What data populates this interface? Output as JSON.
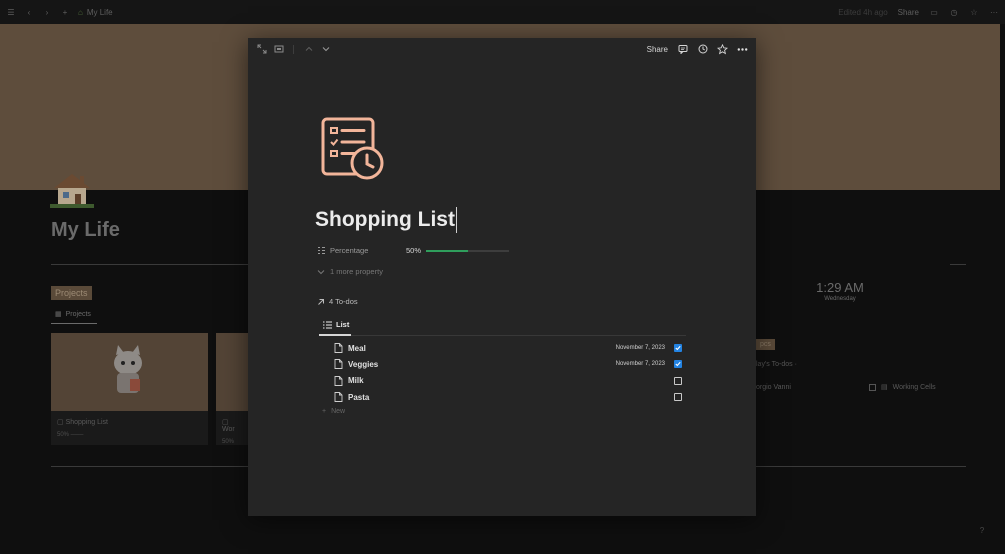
{
  "topbar": {
    "breadcrumb": "My Life",
    "edited": "Edited 4h ago",
    "share": "Share"
  },
  "background": {
    "title": "My Life",
    "projects_heading": "Projects",
    "projects_tab": "Projects",
    "cards": [
      {
        "label": "Shopping List",
        "percent": "50%"
      },
      {
        "label": "Wor",
        "percent": "50%"
      }
    ],
    "clock_time": "1:29 AM",
    "clock_day": "Wednesday",
    "docs_badge": "pcs",
    "todos_label": "lay's To-dos",
    "vanni": "orgio Vanni",
    "working_cells": "Working Cells",
    "help": "?"
  },
  "modal": {
    "toolbar": {
      "share": "Share"
    },
    "title": "Shopping List",
    "properties": [
      {
        "name": "Percentage",
        "value": "50%",
        "progress": 0.5
      }
    ],
    "more_property": "1 more property",
    "relation": "4 To-dos",
    "view_tab": "List",
    "items": [
      {
        "name": "Meal",
        "date": "November 7, 2023",
        "checked": true
      },
      {
        "name": "Veggies",
        "date": "November 7, 2023",
        "checked": true
      },
      {
        "name": "Milk",
        "date": "",
        "checked": false
      },
      {
        "name": "Pasta",
        "date": "",
        "checked": false
      }
    ],
    "new_label": "New"
  },
  "colors": {
    "accent_blue": "#2383e2",
    "progress_green": "#2f9e5c",
    "icon_peach": "#f2b59a",
    "cover_brown": "#5e4d3c"
  }
}
